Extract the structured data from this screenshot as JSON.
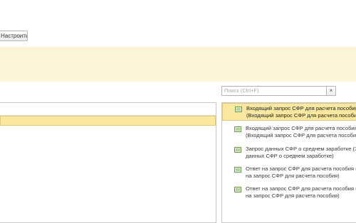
{
  "toolbar": {
    "setup_label": "Настроить..."
  },
  "search": {
    "placeholder": "Поиск (Ctrl+F)",
    "clear_label": "×"
  },
  "items": [
    {
      "line1": "Входящий запрос СФР для расчета пособия",
      "line2": "(Входящий запрос СФР для расчета пособия)",
      "selected": true,
      "icon": "document-icon"
    },
    {
      "line1": "Входящий запрос СФР для расчета пособия",
      "line2": "(Входящий запрос СФР для расчета пособия)",
      "selected": false,
      "icon": "document-icon"
    },
    {
      "line1": "Запрос данных СФР о среднем заработке (Запрос",
      "line2": "данных СФР о среднем заработке)",
      "selected": false,
      "icon": "document-icon"
    },
    {
      "line1": "Ответ на запрос СФР для расчета пособия (Ответ",
      "line2": "на запрос СФР для расчета пособия)",
      "selected": false,
      "icon": "document-icon"
    },
    {
      "line1": "Ответ на запрос СФР для расчета пособия (Ответ",
      "line2": "на запрос СФР для расчета пособия)",
      "selected": false,
      "icon": "document-icon"
    }
  ],
  "colors": {
    "selection": "#fae8a0",
    "banner": "#fcf5d9"
  }
}
